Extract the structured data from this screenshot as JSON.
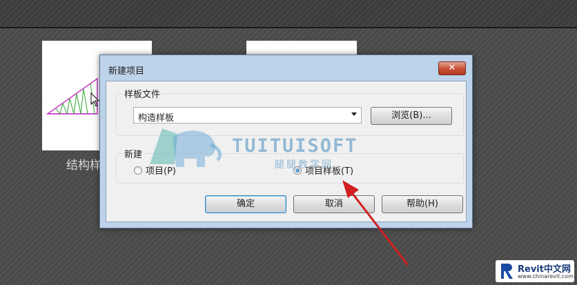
{
  "background": {
    "thumbnail_label": "结构样"
  },
  "dialog": {
    "title": "新建项目",
    "close_label": "✕",
    "template_group": {
      "label": "样板文件",
      "selected_value": "构造样板",
      "browse_label": "浏览(B)..."
    },
    "new_group": {
      "label": "新建",
      "option_project": "项目(P)",
      "option_template": "项目样板(T)",
      "selected": "option_template"
    },
    "buttons": {
      "ok": "确定",
      "cancel": "取消",
      "help": "帮助(H)"
    }
  },
  "watermark": {
    "brand": "TUITUISOFT",
    "sub": "腿腿教学网"
  },
  "corner_logo": {
    "title": "Revit中文网",
    "url": "www.chinarevit.com"
  },
  "colors": {
    "arrow": "#d11f1f",
    "dialog_frame": "#bdd3ea",
    "close_button": "#c75034"
  }
}
